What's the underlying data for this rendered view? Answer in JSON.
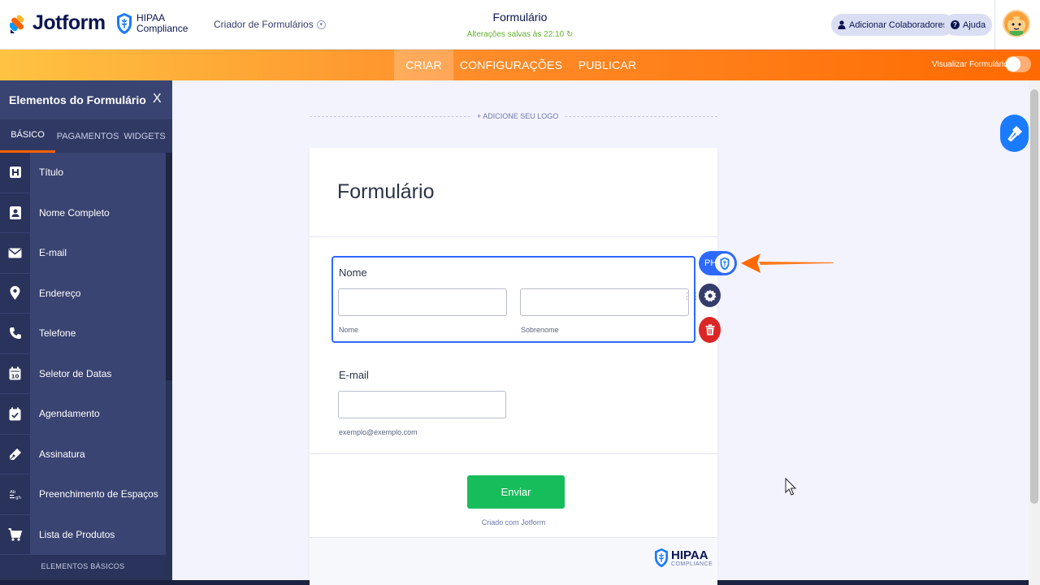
{
  "brand": {
    "name": "Jotform",
    "hipaa_line1": "HIPAA",
    "hipaa_line2": "Compliance"
  },
  "header": {
    "builder_menu": "Criador de Formulários",
    "form_title": "Formulário",
    "saved_status": "Alterações salvas às 22:10",
    "collaborators_label": "Adicionar Colaboradores",
    "help_label": "Ajuda"
  },
  "nav": {
    "tabs": [
      {
        "label": "CRIAR",
        "active": true
      },
      {
        "label": "CONFIGURAÇÕES",
        "active": false
      },
      {
        "label": "PUBLICAR",
        "active": false
      }
    ],
    "preview_label": "Visualizar Formulário",
    "preview_enabled": false
  },
  "sidebar": {
    "title": "Elementos do Formulário",
    "close_label": "X",
    "tabs": [
      {
        "label": "BÁSICO",
        "active": true
      },
      {
        "label": "PAGAMENTOS",
        "active": false
      },
      {
        "label": "WIDGETS",
        "active": false
      }
    ],
    "items": [
      {
        "label": "Título",
        "icon": "heading-icon"
      },
      {
        "label": "Nome Completo",
        "icon": "contact-card-icon"
      },
      {
        "label": "E-mail",
        "icon": "envelope-icon"
      },
      {
        "label": "Endereço",
        "icon": "map-pin-icon"
      },
      {
        "label": "Telefone",
        "icon": "phone-icon"
      },
      {
        "label": "Seletor de Datas",
        "icon": "calendar-icon"
      },
      {
        "label": "Agendamento",
        "icon": "calendar-check-icon"
      },
      {
        "label": "Assinatura",
        "icon": "pen-icon"
      },
      {
        "label": "Preenchimento de Espaços",
        "icon": "fill-blank-icon"
      },
      {
        "label": "Lista de Produtos",
        "icon": "cart-icon"
      }
    ],
    "footer": "ELEMENTOS BÁSICOS"
  },
  "canvas": {
    "add_logo": "+ ADICIONE SEU LOGO",
    "form_heading": "Formulário",
    "name_field": {
      "label": "Nome",
      "first_sublabel": "Nome",
      "last_sublabel": "Sobrenome",
      "first_value": "",
      "last_value": ""
    },
    "email_field": {
      "label": "E-mail",
      "sublabel": "exemplo@exemplo.com",
      "value": ""
    },
    "submit_label": "Enviar",
    "created_with": "Criado com Jotform",
    "footer_hipaa": "HIPAA",
    "footer_compliance": "COMPLIANCE"
  },
  "field_tools": {
    "phi_label": "PHI"
  },
  "colors": {
    "accent": "#2e69ff",
    "orange": "#ff6100",
    "submit": "#18bd5b",
    "sidebar": "#293356",
    "delete": "#dc2626"
  }
}
